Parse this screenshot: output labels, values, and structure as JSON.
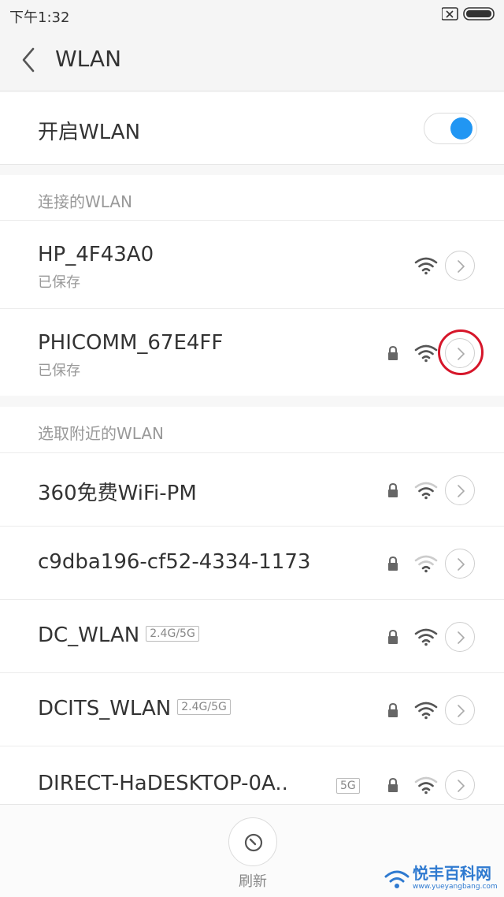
{
  "status_bar": {
    "time": "下午1:32"
  },
  "header": {
    "title": "WLAN"
  },
  "toggle_row": {
    "label": "开启WLAN",
    "enabled": true,
    "accent_color": "#2196f3"
  },
  "connected_section": {
    "header": "连接的WLAN",
    "networks": [
      {
        "name": "HP_4F43A0",
        "status": "已保存",
        "locked": false,
        "signal": "strong"
      },
      {
        "name": "PHICOMM_67E4FF",
        "status": "已保存",
        "locked": true,
        "signal": "strong"
      }
    ]
  },
  "nearby_section": {
    "header": "选取附近的WLAN",
    "networks": [
      {
        "name": "360免费WiFi-PM",
        "band": "",
        "locked": true,
        "signal": "medium"
      },
      {
        "name": "c9dba196-cf52-4334-1173",
        "band": "",
        "locked": true,
        "signal": "weak"
      },
      {
        "name": "DC_WLAN",
        "band": "2.4G/5G",
        "locked": true,
        "signal": "strong"
      },
      {
        "name": "DCITS_WLAN",
        "band": "2.4G/5G",
        "locked": true,
        "signal": "strong"
      },
      {
        "name": "DIRECT-HaDESKTOP-0A..",
        "band": "5G",
        "locked": true,
        "signal": "medium"
      }
    ]
  },
  "footer": {
    "refresh_label": "刷新"
  },
  "watermark": {
    "text": "悦丰百科网",
    "url": "www.yueyangbang.com"
  },
  "colors": {
    "highlight": "#d6162a"
  }
}
